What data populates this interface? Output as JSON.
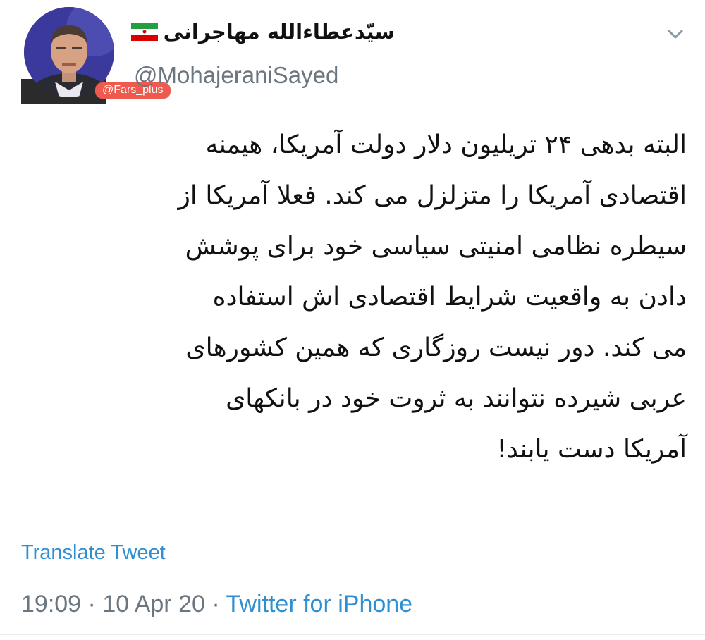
{
  "author": {
    "display_name": "سیّدعطاءالله مهاجرانی",
    "handle": "@MohajeraniSayed",
    "flag_icon": "iran-flag-icon"
  },
  "watermark": {
    "text": "@Fars_plus",
    "color": "#ee5a4d"
  },
  "tweet": {
    "lines": [
      "البته بدهی ۲۴ تریلیون دلار دولت آمریکا، هیمنه",
      "اقتصادی آمریکا را متزلزل می کند. فعلا آمریکا از",
      "سیطره نظامی امنیتی سیاسی خود برای پوشش",
      "دادن به واقعیت شرایط اقتصادی اش استفاده",
      "می کند. دور نیست روزگاری که همین کشورهای",
      "عربی شیرده نتوانند به ثروت خود در بانکهای",
      "آمریکا دست یابند!"
    ],
    "translate_label": "Translate Tweet",
    "time": "19:09",
    "separator": "·",
    "date": "10 Apr 20",
    "source": "Twitter for iPhone"
  },
  "colors": {
    "link": "#2f8fd1",
    "muted": "#6b7680",
    "text": "#111111"
  }
}
